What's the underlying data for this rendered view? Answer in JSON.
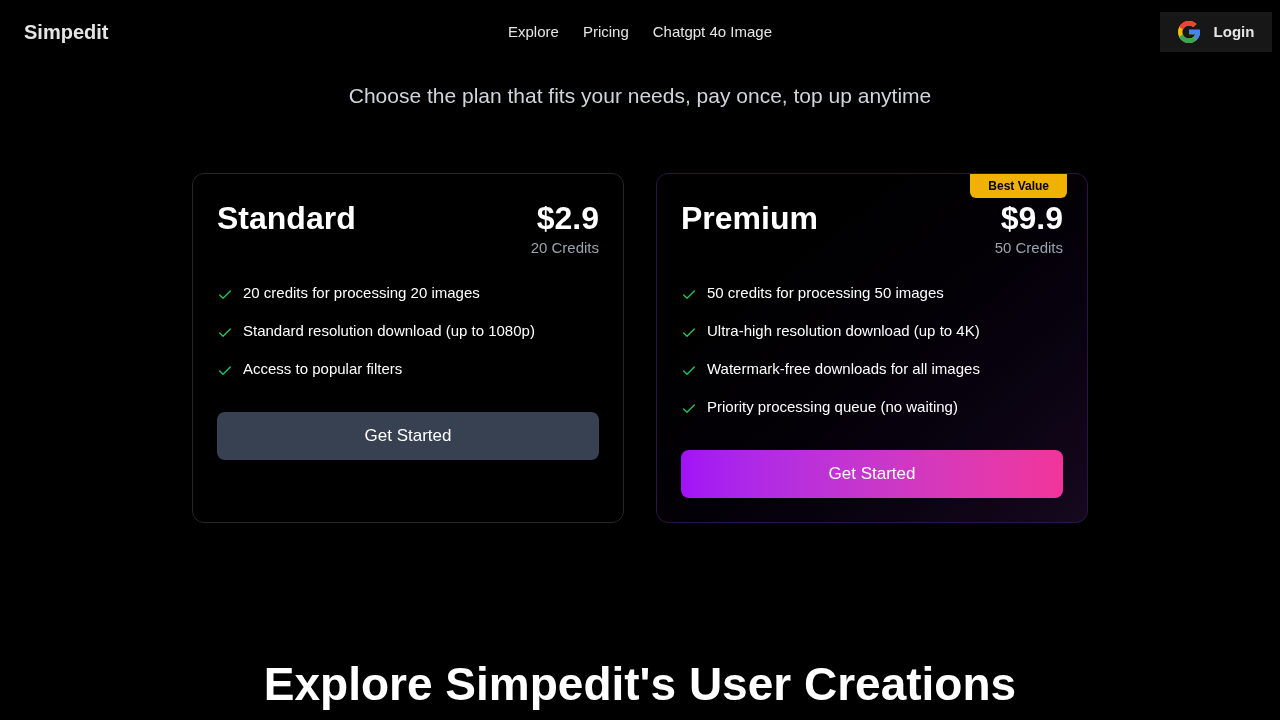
{
  "header": {
    "logo": "Simpedit",
    "nav": [
      {
        "label": "Explore"
      },
      {
        "label": "Pricing"
      },
      {
        "label": "Chatgpt 4o Image"
      }
    ],
    "login_button": "Login"
  },
  "subtitle": "Choose the plan that fits your needs, pay once, top up anytime",
  "plans": [
    {
      "kind": "standard",
      "name": "Standard",
      "price": "$2.9",
      "credits": "20 Credits",
      "features": [
        "20 credits for processing 20 images",
        "Standard resolution download (up to 1080p)",
        "Access to popular filters"
      ],
      "button": "Get Started"
    },
    {
      "kind": "featured",
      "badge": "Best Value",
      "name": "Premium",
      "price": "$9.9",
      "credits": "50 Credits",
      "features": [
        "50 credits for processing 50 images",
        "Ultra-high resolution download (up to 4K)",
        "Watermark-free downloads for all images",
        "Priority processing queue (no waiting)"
      ],
      "button": "Get Started"
    }
  ],
  "section_heading": "Explore Simpedit's User Creations"
}
